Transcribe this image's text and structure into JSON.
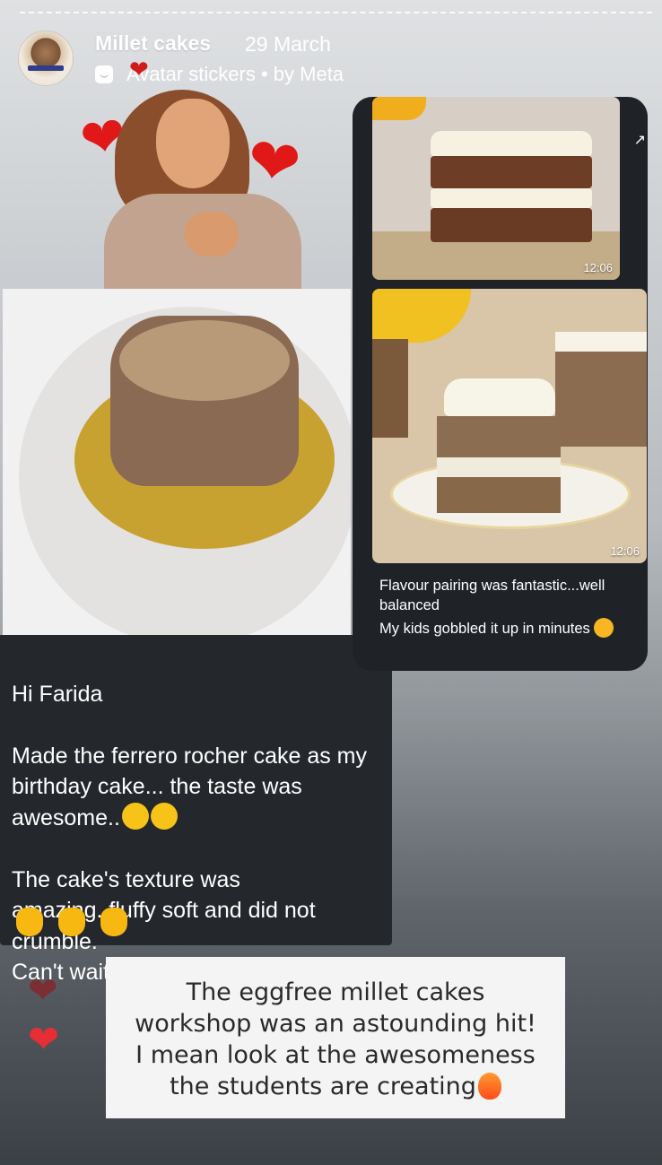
{
  "header": {
    "account_name": "Millet cakes",
    "date": "29 March",
    "sticker_label": "Avatar stickers • by Meta"
  },
  "left_message": {
    "lines": [
      "Hi Farida",
      "Made the ferrero rocher cake as my birthday cake... the taste was awesome.."
    ],
    "body": "The cake's texture was amazing..fluffy soft and did not crumble.\nCan't wait to try rest of them!!"
  },
  "right_message": {
    "timestamp_1": "12:06",
    "timestamp_2": "12:06",
    "caption_line_1": "Flavour pairing was fantastic...well balanced",
    "caption_line_2": "My kids gobbled it up in minutes"
  },
  "story_text": {
    "line_1": "The eggfree millet cakes",
    "line_2": "workshop was an astounding hit!",
    "line_3": "I mean look at the awesomeness",
    "line_4": "the students are creating"
  },
  "colors": {
    "chat_bg": "#24282d",
    "heart_red": "#e01818",
    "white": "#ffffff"
  },
  "icons": [
    "avatar-sticker-icon",
    "heart-icon",
    "share-icon",
    "smile-emoji-icon",
    "ok-hand-emoji-icon",
    "heart-face-emoji-icon",
    "fire-emoji-icon"
  ]
}
